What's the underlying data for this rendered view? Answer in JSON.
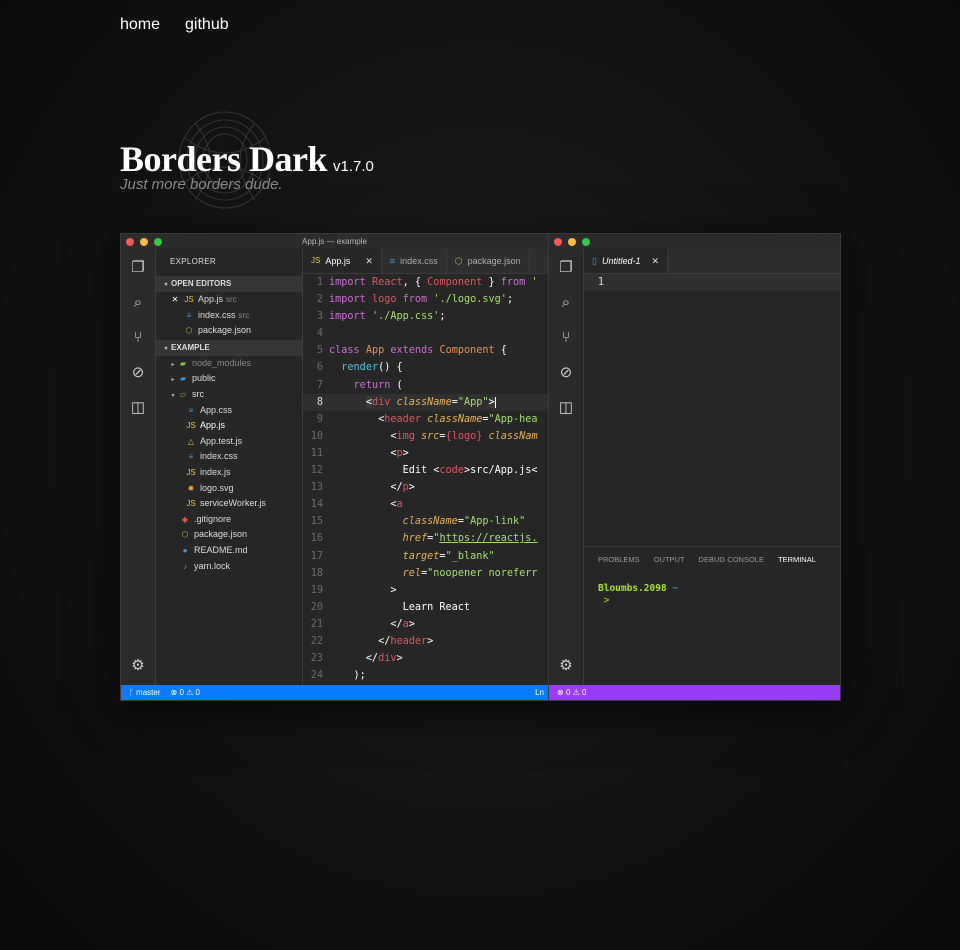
{
  "nav": {
    "home": "home",
    "github": "github"
  },
  "hero": {
    "title": "Borders Dark",
    "version": "v1.7.0",
    "tagline": "Just more borders dude."
  },
  "left_window": {
    "title": "App.js — example",
    "explorer_label": "EXPLORER",
    "open_editors_label": "OPEN EDITORS",
    "open_editors": [
      {
        "name": "App.js",
        "dir": "src",
        "icon": "js-icon"
      },
      {
        "name": "index.css",
        "dir": "src",
        "icon": "css-icon"
      },
      {
        "name": "package.json",
        "dir": "",
        "icon": "npm-icon"
      }
    ],
    "project_label": "EXAMPLE",
    "tree": [
      {
        "name": "node_modules"
      },
      {
        "name": "public"
      },
      {
        "name": "src"
      },
      {
        "name": "App.css"
      },
      {
        "name": "App.js"
      },
      {
        "name": "App.test.js"
      },
      {
        "name": "index.css"
      },
      {
        "name": "index.js"
      },
      {
        "name": "logo.svg"
      },
      {
        "name": "serviceWorker.js"
      },
      {
        "name": ".gitignore"
      },
      {
        "name": "package.json"
      },
      {
        "name": "README.md"
      },
      {
        "name": "yarn.lock"
      }
    ],
    "tabs": [
      {
        "label": "App.js"
      },
      {
        "label": "index.css"
      },
      {
        "label": "package.json"
      }
    ],
    "status": {
      "branch": "master",
      "errors": "0",
      "warnings": "0",
      "position": "Ln"
    }
  },
  "right_window": {
    "tab": "Untitled-1",
    "line": "1",
    "panel_tabs": [
      "PROBLEMS",
      "OUTPUT",
      "DEBUG CONSOLE",
      "TERMINAL"
    ],
    "terminal_user": "Bloumbs.2098",
    "terminal_path": "~",
    "terminal_prompt": ">",
    "status": {
      "errors": "0",
      "warnings": "0"
    }
  },
  "colors": {
    "status_left": "#0a7aff",
    "status_right": "#9b3cf5",
    "close_dot": "#fc5753",
    "min_dot": "#fdbc40",
    "max_dot": "#33c748"
  }
}
